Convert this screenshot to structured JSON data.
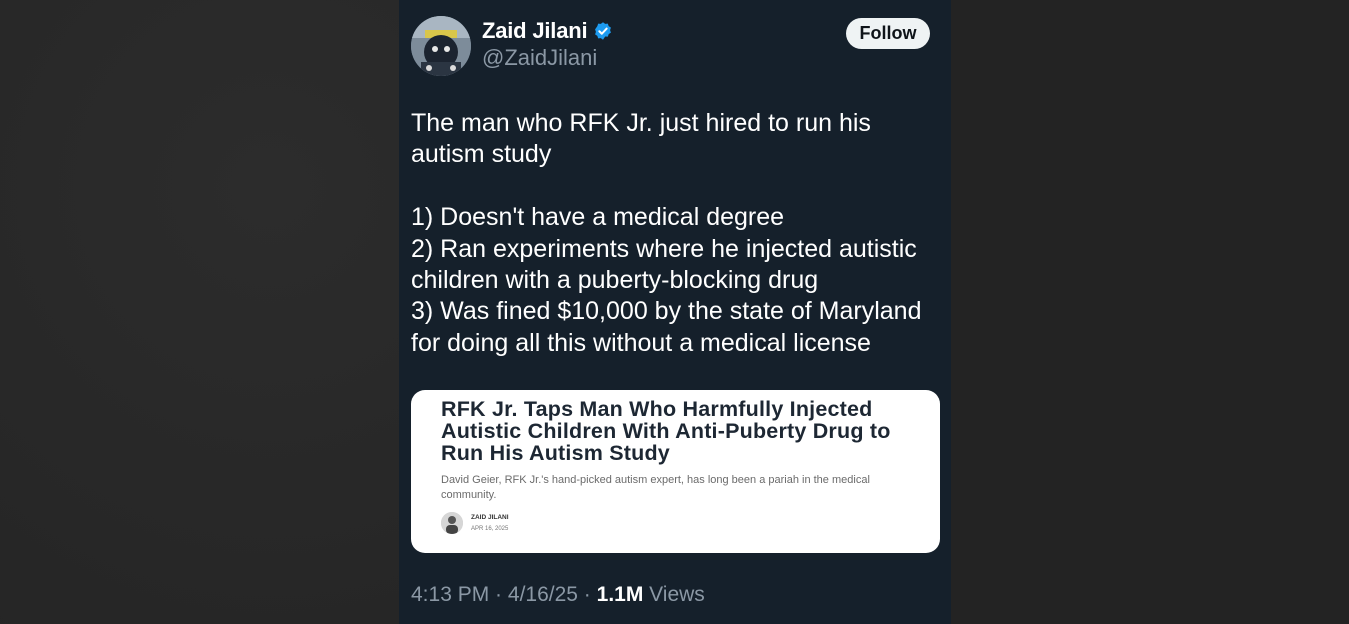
{
  "author": {
    "name": "Zaid Jilani",
    "handle": "@ZaidJilani",
    "verified_icon": "verified-badge-icon",
    "follow_label": "Follow"
  },
  "tweet": {
    "line1": "The man who RFK Jr. just hired to run his autism study",
    "item1": "1) Doesn't have a medical degree",
    "item2": "2) Ran experiments where he injected autistic children with a puberty-blocking drug",
    "item3": "3) Was fined $10,000 by the state of Maryland for doing all this without a medical license"
  },
  "card": {
    "title": "RFK Jr. Taps Man Who Harmfully Injected Autistic Children With Anti-Puberty Drug to Run His Autism Study",
    "subtitle": "David Geier, RFK Jr.'s hand-picked autism expert, has long been a pariah in the medical community.",
    "author": "ZAID JILANI",
    "date": "APR 16, 2025"
  },
  "meta": {
    "time": "4:13 PM",
    "sep1": " · ",
    "date": "4/16/25",
    "sep2": " · ",
    "views_count": "1.1M",
    "views_label": " Views"
  },
  "colors": {
    "background": "#15202b",
    "text": "#ffffff",
    "secondary": "#8b98a5",
    "verified": "#1d9bf0"
  }
}
